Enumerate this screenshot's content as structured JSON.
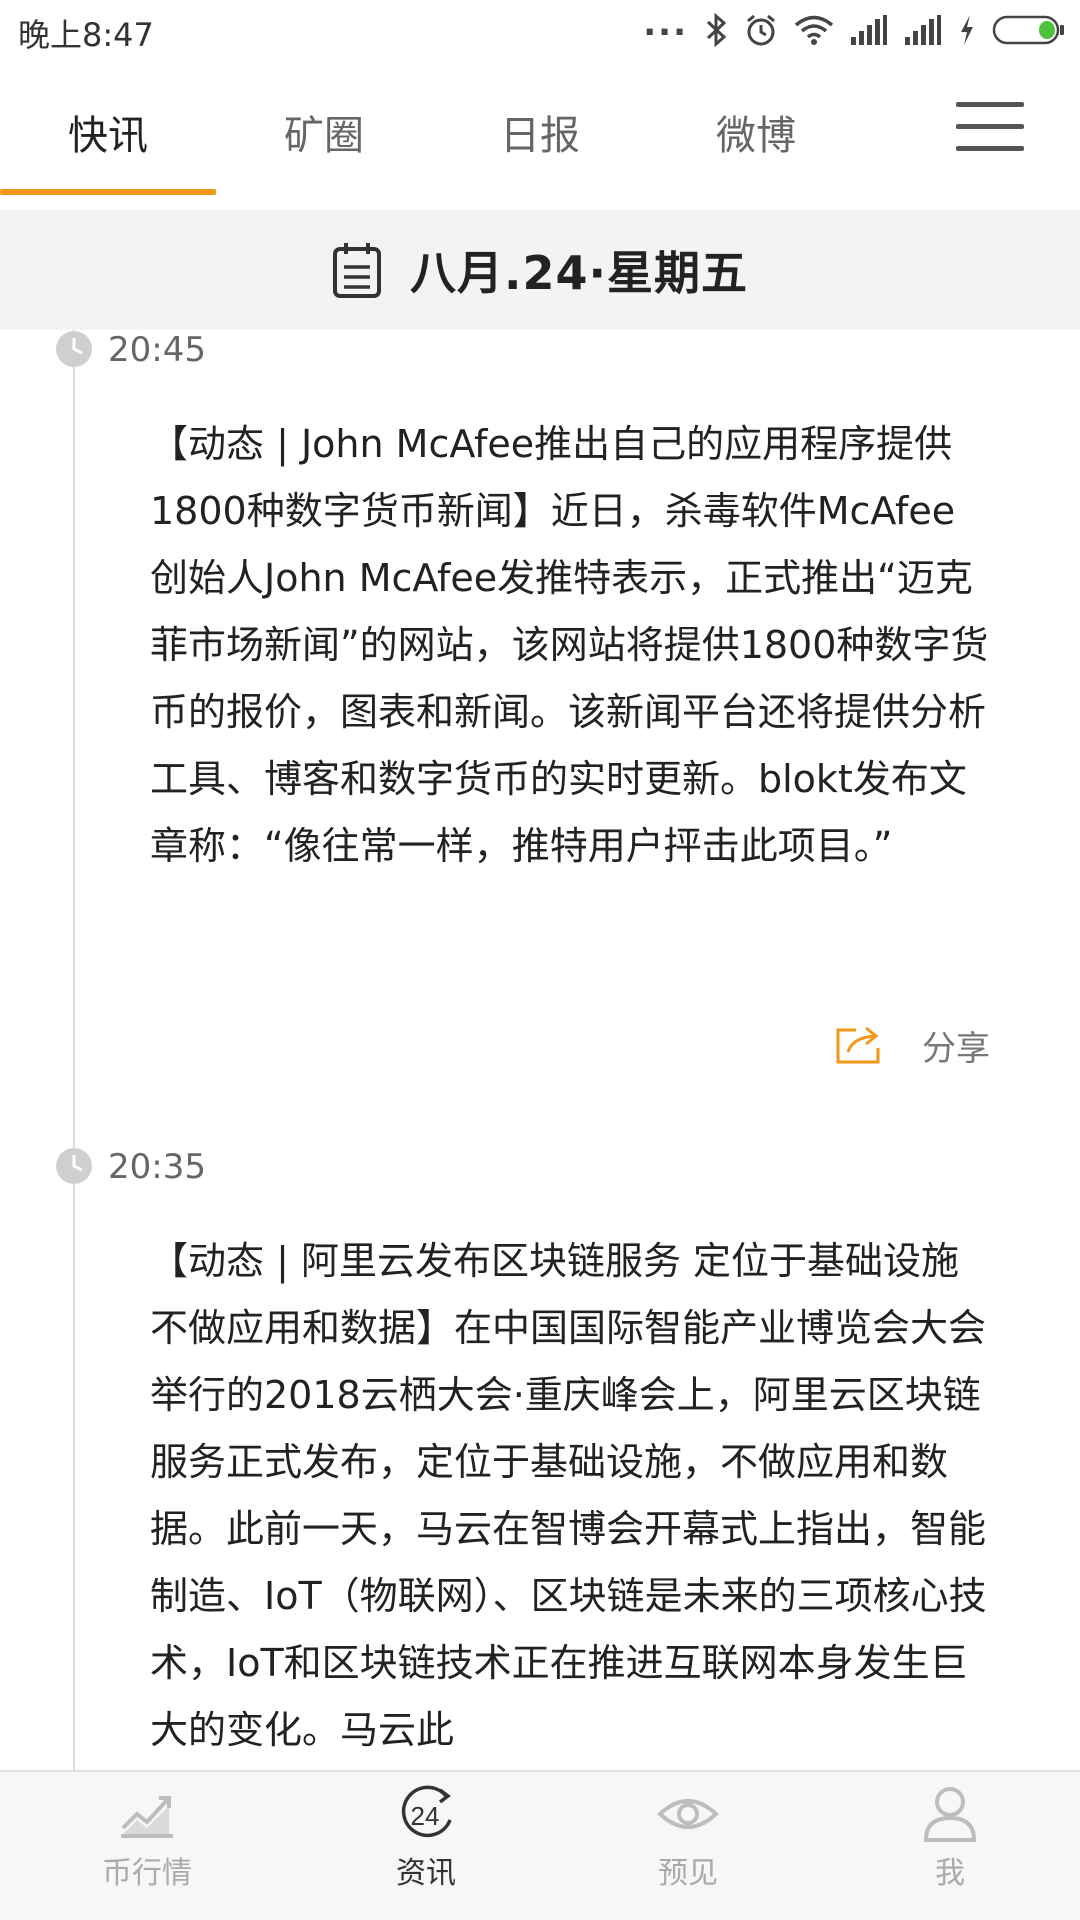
{
  "status_bar": {
    "time": "晚上8:47",
    "dots": "..."
  },
  "tabs": [
    {
      "label": "快讯",
      "active": true
    },
    {
      "label": "矿圈",
      "active": false
    },
    {
      "label": "日报",
      "active": false
    },
    {
      "label": "微博",
      "active": false
    }
  ],
  "accent_color": "#f29818",
  "date_header": {
    "text": "八月.24·星期五"
  },
  "news": [
    {
      "time": "20:45",
      "content": "【动态 | John McAfee推出自己的应用程序提供1800种数字货币新闻】近日，杀毒软件McAfee创始人John McAfee发推特表示，正式推出“迈克菲市场新闻”的网站，该网站将提供1800种数字货币的报价，图表和新闻。该新闻平台还将提供分析工具、博客和数字货币的实时更新。blokt发布文章称：“像往常一样，推特用户抨击此项目。”",
      "share_label": "分享"
    },
    {
      "time": "20:35",
      "content": "【动态 | 阿里云发布区块链服务 定位于基础设施 不做应用和数据】在中国国际智能产业博览会大会举行的2018云栖大会·重庆峰会上，阿里云区块链服务正式发布，定位于基础设施，不做应用和数据。此前一天，马云在智博会开幕式上指出，智能制造、IoT（物联网）、区块链是未来的三项核心技术，IoT和区块链技术正在推进互联网本身发生巨大的变化。马云此"
    }
  ],
  "bottom_nav": [
    {
      "label": "币行情",
      "icon": "chart-icon",
      "active": false
    },
    {
      "label": "资讯",
      "icon": "24h-icon",
      "badge": "24",
      "active": true
    },
    {
      "label": "预见",
      "icon": "eye-icon",
      "active": false
    },
    {
      "label": "我",
      "icon": "user-icon",
      "active": false
    }
  ]
}
